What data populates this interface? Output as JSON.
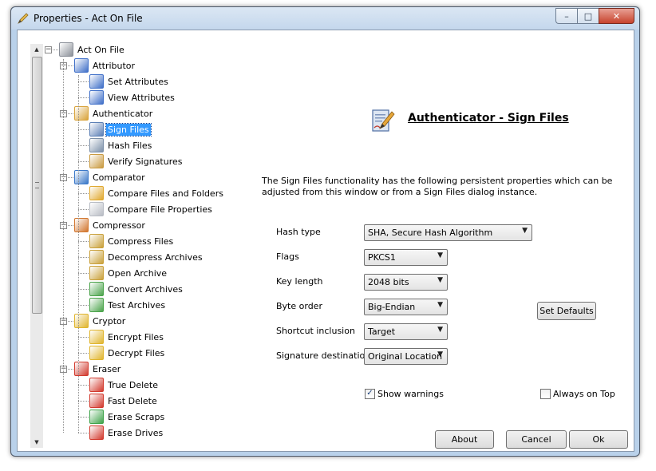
{
  "window": {
    "title": "Properties - Act On File"
  },
  "caption": {
    "minimize": "–",
    "maximize": "□",
    "close": "✕"
  },
  "tree": [
    {
      "label": "Act On File",
      "level": 0,
      "expander": "−",
      "icon": "tools-icon",
      "color": "#8a8f98"
    },
    {
      "label": "Attributor",
      "level": 1,
      "expander": "−",
      "icon": "attributor-icon",
      "color": "#3f6fc8"
    },
    {
      "label": "Set Attributes",
      "level": 2,
      "icon": "set-attributes-icon",
      "color": "#3f6fc8"
    },
    {
      "label": "View Attributes",
      "level": 2,
      "icon": "view-attributes-icon",
      "color": "#3f6fc8"
    },
    {
      "label": "Authenticator",
      "level": 1,
      "expander": "−",
      "icon": "authenticator-icon",
      "color": "#d9a33a"
    },
    {
      "label": "Sign Files",
      "level": 2,
      "icon": "sign-files-icon",
      "color": "#5b7fb5",
      "selected": true
    },
    {
      "label": "Hash Files",
      "level": 2,
      "icon": "hash-files-icon",
      "color": "#7b8fa8"
    },
    {
      "label": "Verify Signatures",
      "level": 2,
      "icon": "verify-signatures-icon",
      "color": "#c99a40"
    },
    {
      "label": "Comparator",
      "level": 1,
      "expander": "−",
      "icon": "comparator-icon",
      "color": "#3a78c9"
    },
    {
      "label": "Compare Files and Folders",
      "level": 2,
      "icon": "compare-folders-icon",
      "color": "#e0a82e"
    },
    {
      "label": "Compare File Properties",
      "level": 2,
      "icon": "compare-properties-icon",
      "color": "#b8bcc4"
    },
    {
      "label": "Compressor",
      "level": 1,
      "expander": "−",
      "icon": "compressor-icon",
      "color": "#d2762e"
    },
    {
      "label": "Compress Files",
      "level": 2,
      "icon": "compress-files-icon",
      "color": "#c9a03a"
    },
    {
      "label": "Decompress Archives",
      "level": 2,
      "icon": "decompress-archives-icon",
      "color": "#c9a03a"
    },
    {
      "label": "Open Archive",
      "level": 2,
      "icon": "open-archive-icon",
      "color": "#c9a03a"
    },
    {
      "label": "Convert Archives",
      "level": 2,
      "icon": "convert-archives-icon",
      "color": "#4aa34a"
    },
    {
      "label": "Test Archives",
      "level": 2,
      "icon": "test-archives-icon",
      "color": "#4aa34a"
    },
    {
      "label": "Cryptor",
      "level": 1,
      "expander": "−",
      "icon": "cryptor-icon",
      "color": "#e0b52e"
    },
    {
      "label": "Encrypt Files",
      "level": 2,
      "icon": "encrypt-files-icon",
      "color": "#e0b52e"
    },
    {
      "label": "Decrypt Files",
      "level": 2,
      "icon": "decrypt-files-icon",
      "color": "#e0b52e"
    },
    {
      "label": "Eraser",
      "level": 1,
      "expander": "−",
      "icon": "eraser-icon",
      "color": "#d23a2e"
    },
    {
      "label": "True Delete",
      "level": 2,
      "icon": "true-delete-icon",
      "color": "#d23a2e"
    },
    {
      "label": "Fast Delete",
      "level": 2,
      "icon": "fast-delete-icon",
      "color": "#d23a2e"
    },
    {
      "label": "Erase Scraps",
      "level": 2,
      "icon": "erase-scraps-icon",
      "color": "#3fa34a"
    },
    {
      "label": "Erase Drives",
      "level": 2,
      "icon": "erase-drives-icon",
      "color": "#d23a2e"
    }
  ],
  "scrollbar": {
    "up": "▲",
    "down": "▼"
  },
  "pane": {
    "heading": "Authenticator - Sign Files",
    "description": "The Sign Files functionality has the following persistent properties which can be adjusted from this window or from a Sign Files dialog instance."
  },
  "fields": {
    "hash_type": {
      "label": "Hash type",
      "value": "SHA, Secure Hash Algorithm"
    },
    "flags": {
      "label": "Flags",
      "value": "PKCS1"
    },
    "key_length": {
      "label": "Key length",
      "value": "2048 bits"
    },
    "byte_order": {
      "label": "Byte order",
      "value": "Big-Endian"
    },
    "shortcut_inclusion": {
      "label": "Shortcut inclusion",
      "value": "Target"
    },
    "signature_destination": {
      "label": "Signature destination",
      "value": "Original Location"
    }
  },
  "buttons": {
    "set_defaults": "Set Defaults",
    "about": "About",
    "cancel": "Cancel",
    "ok": "Ok"
  },
  "checkboxes": {
    "show_warnings": {
      "label": "Show warnings",
      "checked": true,
      "mark": "✓"
    },
    "always_on_top": {
      "label": "Always on Top",
      "checked": false
    }
  },
  "combo_arrow": "▼"
}
